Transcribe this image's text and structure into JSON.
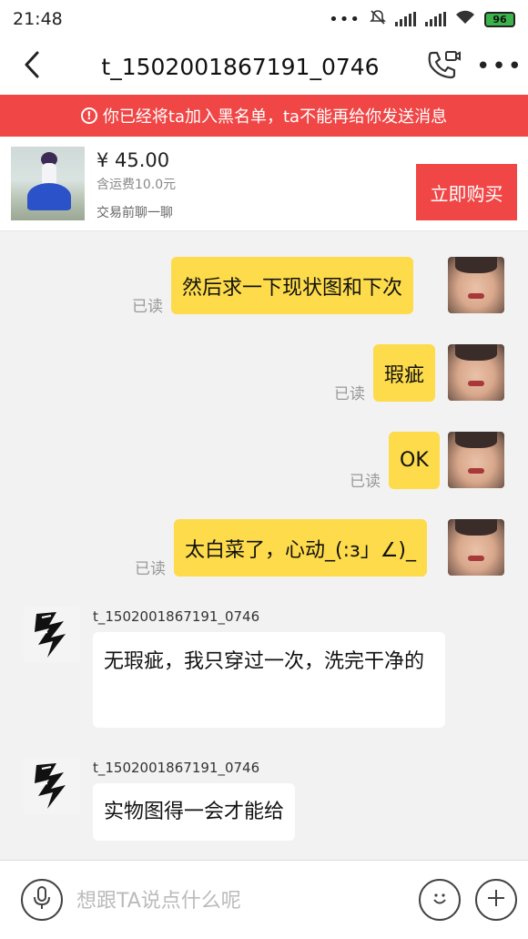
{
  "status_bar": {
    "time": "21:48",
    "battery": "96",
    "icons": [
      "more-dots-icon",
      "mute-bell-icon",
      "signal-icon",
      "signal-icon",
      "wifi-icon",
      "battery-icon"
    ]
  },
  "header": {
    "title": "t_1502001867191_0746",
    "back_icon": "back-chevron-icon",
    "call_icon": "phone-video-icon",
    "more_label": "•••"
  },
  "banner": {
    "icon": "!",
    "text": "你已经将ta加入黑名单，ta不能再给你发送消息",
    "color": "#f04646"
  },
  "product": {
    "price": "¥ 45.00",
    "shipping": "含运费10.0元",
    "hint": "交易前聊一聊",
    "buy_label": "立即购买"
  },
  "messages": {
    "outgoing": [
      {
        "text": "然后求一下现状图和下次",
        "status": "已读"
      },
      {
        "text": "瑕疵",
        "status": "已读"
      },
      {
        "text": "OK",
        "status": "已读"
      },
      {
        "text": "太白菜了，心动_(:з」∠)_",
        "status": "已读"
      }
    ],
    "incoming": [
      {
        "sender": "t_1502001867191_0746",
        "text": "无瑕疵，我只穿过一次，洗完干净的"
      },
      {
        "sender": "t_1502001867191_0746",
        "text": "实物图得一会才能给"
      }
    ]
  },
  "input": {
    "placeholder": "想跟TA说点什么呢"
  },
  "colors": {
    "accent": "#f04646",
    "my_bubble": "#fddb4b",
    "background": "#f2f2f2"
  }
}
